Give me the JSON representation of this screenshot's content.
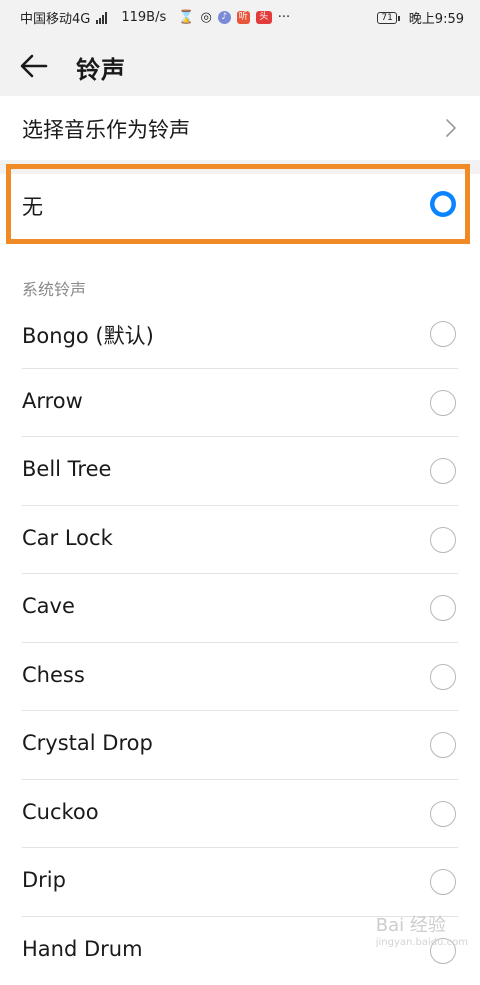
{
  "status_bar": {
    "carrier": "中国移动4G",
    "net_speed": "119B/s",
    "battery": "71",
    "time": "晚上9:59",
    "icons": [
      "signal-icon",
      "hourglass-icon",
      "wifi-icon",
      "music-icon",
      "ting-icon",
      "toutiao-icon",
      "more-icon"
    ]
  },
  "appbar": {
    "title": "铃声",
    "back_icon": "arrow-left-icon"
  },
  "choose_music": {
    "label": "选择音乐作为铃声",
    "icon": "chevron-right-icon"
  },
  "none_option": {
    "label": "无",
    "selected": true
  },
  "section_header": "系统铃声",
  "ringtones": [
    {
      "label": "Bongo (默认)"
    },
    {
      "label": "Arrow"
    },
    {
      "label": "Bell Tree"
    },
    {
      "label": "Car Lock"
    },
    {
      "label": "Cave"
    },
    {
      "label": "Chess"
    },
    {
      "label": "Crystal Drop"
    },
    {
      "label": "Cuckoo"
    },
    {
      "label": "Drip"
    },
    {
      "label": "Hand Drum"
    }
  ],
  "watermark": {
    "text": "Bai 经验",
    "sub": "jingyan.baidu.com"
  },
  "colors": {
    "accent": "#0a84ff",
    "highlight": "#f08a24",
    "background": "#f2f2f2"
  }
}
